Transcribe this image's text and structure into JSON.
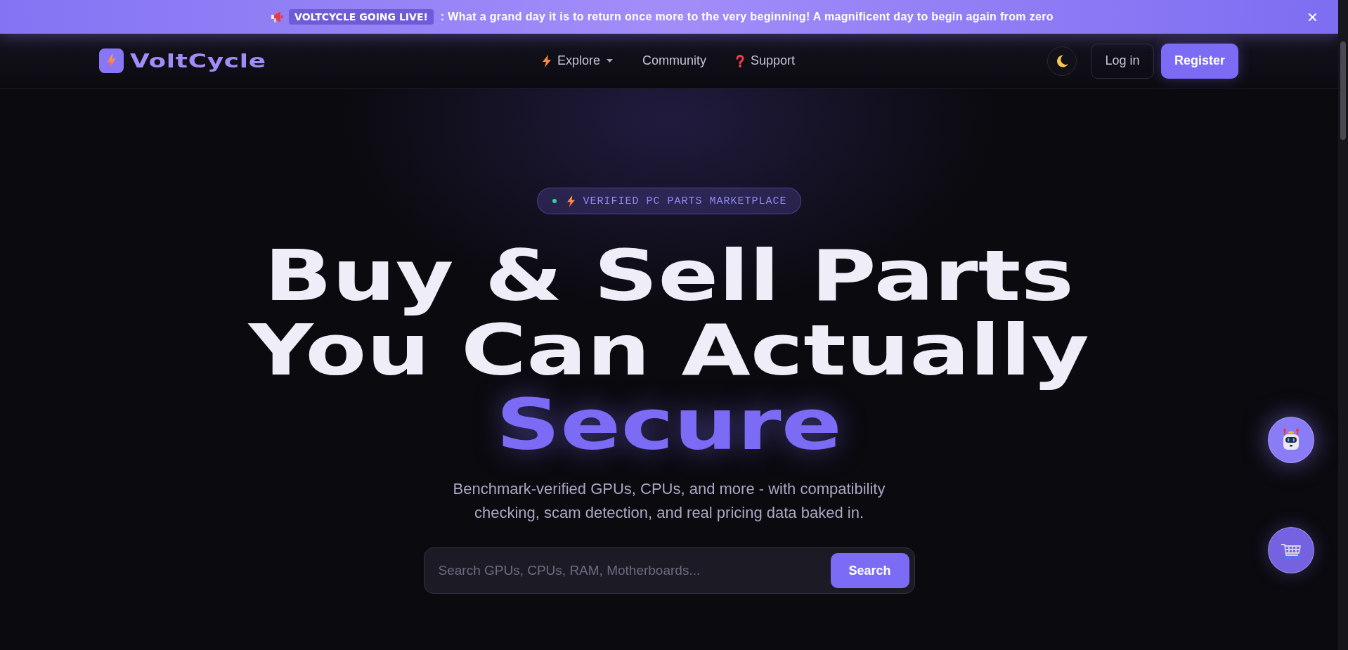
{
  "announcement": {
    "badge": "VOLTCYCLE GOING LIVE!",
    "text": ": What a grand day it is to return once more to the very beginning! A magnificent day to begin again from zero"
  },
  "nav": {
    "brand": "VoltCycle",
    "links": [
      {
        "label": "Explore",
        "kind": "menu"
      },
      {
        "label": "Community",
        "kind": "link"
      },
      {
        "label": "Support",
        "kind": "help"
      }
    ],
    "login": "Log in",
    "register": "Register"
  },
  "hero": {
    "badge": "VERIFIED PC PARTS MARKETPLACE",
    "heading_lines": [
      "Buy & Sell Parts",
      "You Can Actually"
    ],
    "highlight": "Secure",
    "subtitle": "Benchmark-verified GPUs, CPUs, and more - with compatibility checking, scam detection, and real pricing data baked in.",
    "search": {
      "placeholder": "Search GPUs, CPUs, RAM, Motherboards...",
      "button": "Search"
    }
  }
}
